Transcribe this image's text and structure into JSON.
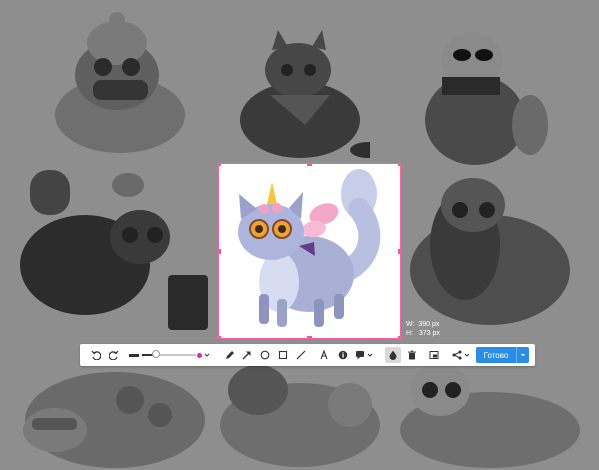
{
  "selection": {
    "width_label": "W:",
    "width_value": "390 px",
    "height_label": "H:",
    "height_value": "373 px"
  },
  "toolbar": {
    "undo_icon": "undo-icon",
    "redo_icon": "redo-icon",
    "stroke_width_percent": 25,
    "color": "#e020c0",
    "tools": [
      "pencil-icon",
      "arrow-icon",
      "ellipse-icon",
      "rectangle-icon",
      "line-icon",
      "text-icon",
      "numbered-marker-icon",
      "callout-icon",
      "blur-icon",
      "trash-icon",
      "crop-icon",
      "share-icon"
    ],
    "done_label": "Готово",
    "accent": "#2a8ee8"
  }
}
